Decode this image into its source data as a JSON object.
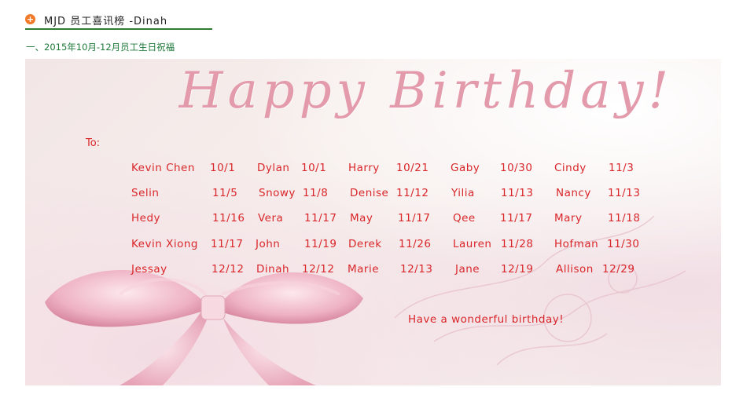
{
  "header": {
    "icon": "plus-icon",
    "title": "MJD 员工喜讯榜 -Dinah"
  },
  "subtitle": "一、2015年10月-12月员工生日祝福",
  "card": {
    "heading": "Happy Birthday!",
    "to_label": "To:",
    "wish": "Have a wonderful birthday!",
    "accent_color": "#d9262a",
    "rows": [
      [
        {
          "name": "Kevin Chen",
          "date": "10/1"
        },
        {
          "name": "Dylan",
          "date": "10/1"
        },
        {
          "name": "Harry",
          "date": "10/21"
        },
        {
          "name": "Gaby",
          "date": "10/30"
        },
        {
          "name": "Cindy",
          "date": "11/3"
        }
      ],
      [
        {
          "name": "Selin",
          "date": "11/5"
        },
        {
          "name": "Snowy",
          "date": "11/8"
        },
        {
          "name": "Denise",
          "date": "11/12"
        },
        {
          "name": "Yilia",
          "date": "11/13"
        },
        {
          "name": "Nancy",
          "date": "11/13"
        }
      ],
      [
        {
          "name": "Hedy",
          "date": "11/16"
        },
        {
          "name": "Vera",
          "date": "11/17"
        },
        {
          "name": "May",
          "date": "11/17"
        },
        {
          "name": "Qee",
          "date": "11/17"
        },
        {
          "name": "Mary",
          "date": "11/18"
        }
      ],
      [
        {
          "name": "Kevin Xiong",
          "date": "11/17"
        },
        {
          "name": "John",
          "date": "11/19"
        },
        {
          "name": "Derek",
          "date": "11/26"
        },
        {
          "name": "Lauren",
          "date": "11/28"
        },
        {
          "name": "Hofman",
          "date": "11/30"
        }
      ],
      [
        {
          "name": "Jessay",
          "date": "12/12"
        },
        {
          "name": "Dinah",
          "date": "12/12"
        },
        {
          "name": "Marie",
          "date": "12/13"
        },
        {
          "name": "Jane",
          "date": "12/19"
        },
        {
          "name": "Allison",
          "date": "12/29"
        }
      ]
    ]
  }
}
